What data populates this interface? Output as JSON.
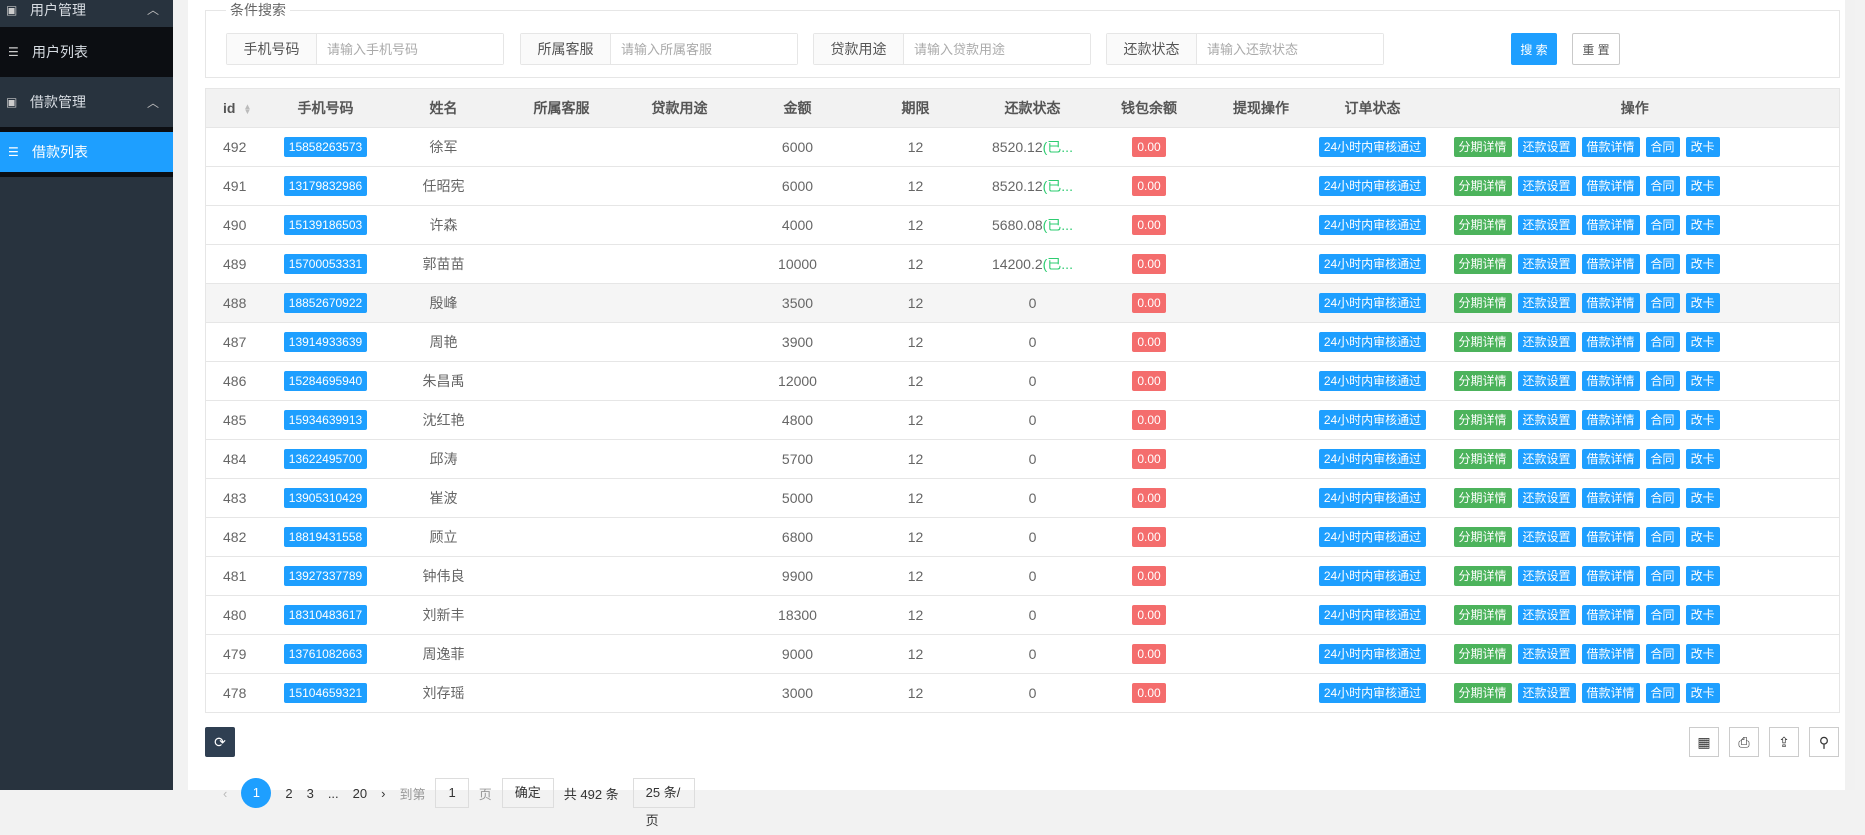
{
  "sidebar": {
    "user_mgmt": "用户管理",
    "user_list": "用户列表",
    "loan_mgmt": "借款管理",
    "loan_list": "借款列表"
  },
  "search": {
    "legend": "条件搜索",
    "fields": [
      {
        "label": "手机号码",
        "placeholder": "请输入手机号码"
      },
      {
        "label": "所属客服",
        "placeholder": "请输入所属客服"
      },
      {
        "label": "贷款用途",
        "placeholder": "请输入贷款用途"
      },
      {
        "label": "还款状态",
        "placeholder": "请输入还款状态"
      }
    ],
    "search_btn": "搜 索",
    "reset_btn": "重 置"
  },
  "table": {
    "headers": [
      "id",
      "手机号码",
      "姓名",
      "所属客服",
      "贷款用途",
      "金额",
      "期限",
      "还款状态",
      "钱包余额",
      "提现操作",
      "订单状态",
      "操作"
    ],
    "ops": [
      "分期详情",
      "还款设置",
      "借款详情",
      "合同",
      "改卡"
    ],
    "rows": [
      {
        "id": "492",
        "phone": "15858263573",
        "name": "徐军",
        "amount": "6000",
        "term": "12",
        "repay": "8520.12",
        "repay_note": "(已...",
        "wallet": "0.00",
        "status": "24小时内审核通过"
      },
      {
        "id": "491",
        "phone": "13179832986",
        "name": "任昭宪",
        "amount": "6000",
        "term": "12",
        "repay": "8520.12",
        "repay_note": "(已...",
        "wallet": "0.00",
        "status": "24小时内审核通过"
      },
      {
        "id": "490",
        "phone": "15139186503",
        "name": "许森",
        "amount": "4000",
        "term": "12",
        "repay": "5680.08",
        "repay_note": "(已...",
        "wallet": "0.00",
        "status": "24小时内审核通过"
      },
      {
        "id": "489",
        "phone": "15700053331",
        "name": "郭苗苗",
        "amount": "10000",
        "term": "12",
        "repay": "14200.2",
        "repay_note": "(已...",
        "wallet": "0.00",
        "status": "24小时内审核通过"
      },
      {
        "id": "488",
        "phone": "18852670922",
        "name": "殷峰",
        "amount": "3500",
        "term": "12",
        "repay": "0",
        "repay_note": "",
        "wallet": "0.00",
        "status": "24小时内审核通过",
        "hover": true
      },
      {
        "id": "487",
        "phone": "13914933639",
        "name": "周艳",
        "amount": "3900",
        "term": "12",
        "repay": "0",
        "repay_note": "",
        "wallet": "0.00",
        "status": "24小时内审核通过"
      },
      {
        "id": "486",
        "phone": "15284695940",
        "name": "朱昌禹",
        "amount": "12000",
        "term": "12",
        "repay": "0",
        "repay_note": "",
        "wallet": "0.00",
        "status": "24小时内审核通过"
      },
      {
        "id": "485",
        "phone": "15934639913",
        "name": "沈红艳",
        "amount": "4800",
        "term": "12",
        "repay": "0",
        "repay_note": "",
        "wallet": "0.00",
        "status": "24小时内审核通过"
      },
      {
        "id": "484",
        "phone": "13622495700",
        "name": "邱涛",
        "amount": "5700",
        "term": "12",
        "repay": "0",
        "repay_note": "",
        "wallet": "0.00",
        "status": "24小时内审核通过"
      },
      {
        "id": "483",
        "phone": "13905310429",
        "name": "崔波",
        "amount": "5000",
        "term": "12",
        "repay": "0",
        "repay_note": "",
        "wallet": "0.00",
        "status": "24小时内审核通过"
      },
      {
        "id": "482",
        "phone": "18819431558",
        "name": "顾立",
        "amount": "6800",
        "term": "12",
        "repay": "0",
        "repay_note": "",
        "wallet": "0.00",
        "status": "24小时内审核通过"
      },
      {
        "id": "481",
        "phone": "13927337789",
        "name": "钟伟良",
        "amount": "9900",
        "term": "12",
        "repay": "0",
        "repay_note": "",
        "wallet": "0.00",
        "status": "24小时内审核通过"
      },
      {
        "id": "480",
        "phone": "18310483617",
        "name": "刘新丰",
        "amount": "18300",
        "term": "12",
        "repay": "0",
        "repay_note": "",
        "wallet": "0.00",
        "status": "24小时内审核通过"
      },
      {
        "id": "479",
        "phone": "13761082663",
        "name": "周逸菲",
        "amount": "9000",
        "term": "12",
        "repay": "0",
        "repay_note": "",
        "wallet": "0.00",
        "status": "24小时内审核通过"
      },
      {
        "id": "478",
        "phone": "15104659321",
        "name": "刘存瑶",
        "amount": "3000",
        "term": "12",
        "repay": "0",
        "repay_note": "",
        "wallet": "0.00",
        "status": "24小时内审核通过"
      }
    ]
  },
  "pager": {
    "prev": "‹",
    "pages": [
      "1",
      "2",
      "3",
      "...",
      "20"
    ],
    "next": "›",
    "goto": "到第",
    "page_value": "1",
    "page_unit": "页",
    "confirm": "确定",
    "total": "共 492 条",
    "per_page": "25 条/页"
  }
}
